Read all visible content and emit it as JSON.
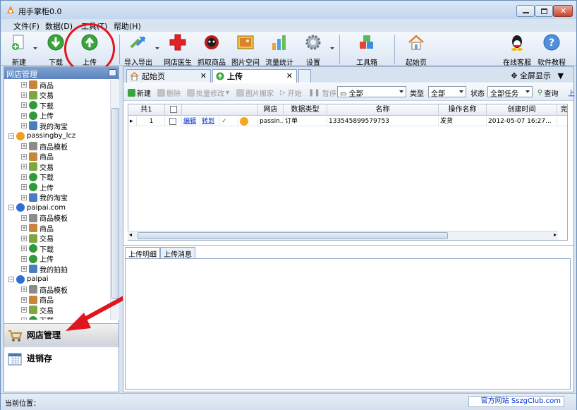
{
  "window": {
    "title": "用手掌柜0.0"
  },
  "menu": [
    "文件(F)",
    "数据(D)",
    "工具(T)",
    "帮助(H)"
  ],
  "toolbar": {
    "buttons": [
      {
        "label": "新建",
        "icon": "new-doc-icon"
      },
      {
        "label": "下载",
        "icon": "download-icon"
      },
      {
        "label": "上传",
        "icon": "upload-icon"
      },
      {
        "label": "导入导出",
        "icon": "import-export-icon"
      },
      {
        "label": "网店医生",
        "icon": "red-cross-icon"
      },
      {
        "label": "抓取商品",
        "icon": "spider-icon"
      },
      {
        "label": "图片空间",
        "icon": "picture-icon"
      },
      {
        "label": "流量统计",
        "icon": "bar-chart-icon"
      },
      {
        "label": "设置",
        "icon": "gear-icon"
      },
      {
        "label": "工具箱",
        "icon": "toolbox-icon"
      },
      {
        "label": "起始页",
        "icon": "home-icon"
      },
      {
        "label": "在线客服",
        "icon": "qq-icon"
      },
      {
        "label": "软件教程",
        "icon": "help-icon"
      }
    ]
  },
  "left": {
    "header": "网店管理",
    "tree": [
      {
        "label": "商品",
        "level": 1,
        "icon": "box"
      },
      {
        "label": "交易",
        "level": 1,
        "icon": "trade"
      },
      {
        "label": "下载",
        "level": 1,
        "icon": "download"
      },
      {
        "label": "上传",
        "level": 1,
        "icon": "upload"
      },
      {
        "label": "我的淘宝",
        "level": 1,
        "icon": "network"
      },
      {
        "label": "passingby_lcz",
        "level": 0,
        "icon": "taobao"
      },
      {
        "label": "商品模板",
        "level": 1,
        "icon": "template"
      },
      {
        "label": "商品",
        "level": 1,
        "icon": "box"
      },
      {
        "label": "交易",
        "level": 1,
        "icon": "trade"
      },
      {
        "label": "下载",
        "level": 1,
        "icon": "download"
      },
      {
        "label": "上传",
        "level": 1,
        "icon": "upload"
      },
      {
        "label": "我的淘宝",
        "level": 1,
        "icon": "network"
      },
      {
        "label": "paipai.com",
        "level": 0,
        "icon": "paipai"
      },
      {
        "label": "商品模板",
        "level": 1,
        "icon": "template"
      },
      {
        "label": "商品",
        "level": 1,
        "icon": "box"
      },
      {
        "label": "交易",
        "level": 1,
        "icon": "trade"
      },
      {
        "label": "下载",
        "level": 1,
        "icon": "download"
      },
      {
        "label": "上传",
        "level": 1,
        "icon": "upload"
      },
      {
        "label": "我的拍拍",
        "level": 1,
        "icon": "network"
      },
      {
        "label": "paipai",
        "level": 0,
        "icon": "paipai"
      },
      {
        "label": "商品模板",
        "level": 1,
        "icon": "template"
      },
      {
        "label": "商品",
        "level": 1,
        "icon": "box"
      },
      {
        "label": "交易",
        "level": 1,
        "icon": "trade"
      },
      {
        "label": "下载",
        "level": 1,
        "icon": "download"
      }
    ],
    "nav": [
      {
        "label": "网店管理",
        "active": true
      },
      {
        "label": "进销存",
        "active": false
      }
    ]
  },
  "tabs": [
    {
      "label": "起始页",
      "active": false
    },
    {
      "label": "上传",
      "active": true
    }
  ],
  "fullscreen_label": "全屏显示",
  "actions": {
    "new": "新建",
    "delete": "删除",
    "batch": "批量修改",
    "move_images": "图片搬家",
    "start": "开始",
    "pause": "暂停",
    "filter_value": "全部",
    "type_label": "类型",
    "type_value": "全部",
    "state_label": "状态",
    "state_value": "全部任务",
    "search": "查询",
    "overflow": "上"
  },
  "grid": {
    "count_header": "共1",
    "columns": [
      "网店",
      "数据类型",
      "名称",
      "操作名称",
      "创建时间",
      "完"
    ],
    "rows": [
      {
        "num": "1",
        "edit": "编辑",
        "goto": "转到",
        "shop": "passin...",
        "type": "订单",
        "name": "133545899579753",
        "op": "发货",
        "created": "2012-05-07 16:27..."
      }
    ]
  },
  "detail_tabs": [
    {
      "label": "上传明细",
      "active": true
    },
    {
      "label": "上传消息",
      "active": false
    }
  ],
  "status": {
    "location_label": "当前位置：",
    "site": "官方网站 SszgClub.com"
  }
}
